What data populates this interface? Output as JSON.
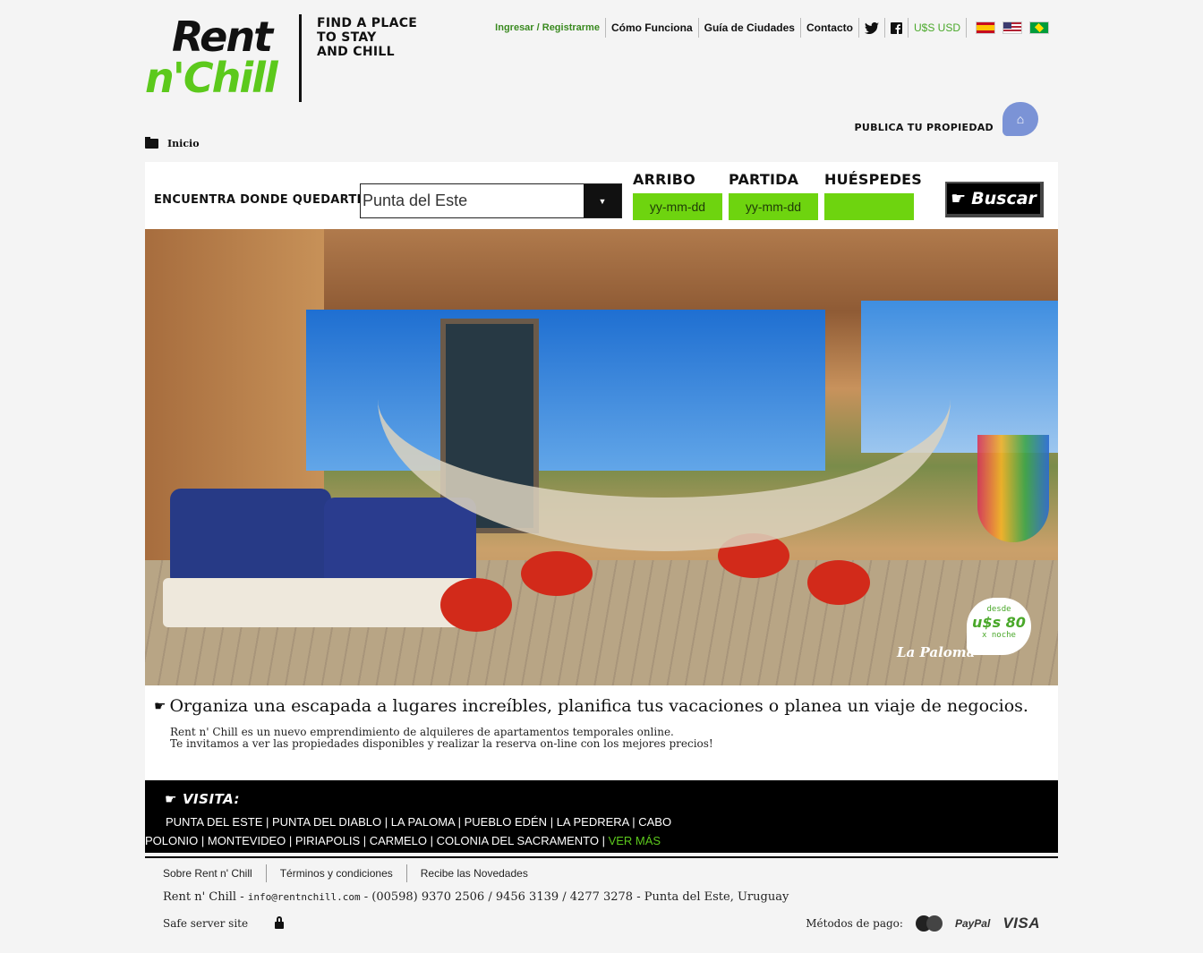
{
  "header": {
    "logo_top": "Rent",
    "logo_bottom": "n'Chill",
    "tagline": "FIND A PLACE\nTO STAY\nAND CHILL",
    "nav": {
      "login": "Ingresar / Registrarme",
      "how": "Cómo Funciona",
      "guide": "Guía de Ciudades",
      "contact": "Contacto",
      "currency": "U$S USD"
    },
    "publish": "PUBLICA TU PROPIEDAD",
    "breadcrumb": "Inicio"
  },
  "search": {
    "label": "ENCUENTRA DONDE QUEDARTE",
    "city": "Punta del Este",
    "arrival_label": "ARRIBO",
    "arrival_value": "yy-mm-dd",
    "departure_label": "PARTIDA",
    "departure_value": "yy-mm-dd",
    "guests_label": "HUÉSPEDES",
    "guests_value": "",
    "button": "Buscar"
  },
  "hero": {
    "place": "La Paloma",
    "price_from": "desde",
    "price": "u$s 80",
    "price_unit": "x noche"
  },
  "intro": {
    "heading": "Organiza una escapada a lugares increíbles, planifica tus vacaciones o planea un viaje de negocios.",
    "line1": "Rent n' Chill es un nuevo emprendimiento de alquileres de apartamentos temporales online.",
    "line2": "Te invitamos a ver las propiedades disponibles y realizar la reserva on-line con los mejores precios!"
  },
  "visita": {
    "title": "VISITA:",
    "cities": [
      "PUNTA DEL ESTE",
      "PUNTA DEL DIABLO",
      "LA PALOMA",
      "PUEBLO EDÉN",
      "LA PEDRERA",
      "CABO POLONIO",
      "MONTEVIDEO",
      "PIRIAPOLIS",
      "CARMELO",
      "COLONIA DEL SACRAMENTO"
    ],
    "more": "VER MÁS"
  },
  "footer": {
    "about": "Sobre Rent n' Chill",
    "terms": "Términos y condiciones",
    "news": "Recibe las Novedades",
    "contact_prefix": "Rent n' Chill - ",
    "email": "info@rentnchill.com",
    "contact_suffix": " - (00598) 9370 2506 / 9456 3139 / 4277 3278 - Punta del Este, Uruguay",
    "safe": "Safe server site",
    "payments_label": "Métodos de pago:",
    "paypal": "PayPal",
    "visa": "VISA"
  },
  "colors": {
    "brand_green": "#5cc91c",
    "field_green": "#6ed40f",
    "bubble_blue": "#7b93d6"
  },
  "icons": [
    "twitter-icon",
    "facebook-icon",
    "folder-icon",
    "home-icon",
    "pointing-hand-icon",
    "lock-icon",
    "mastercard-icon"
  ]
}
